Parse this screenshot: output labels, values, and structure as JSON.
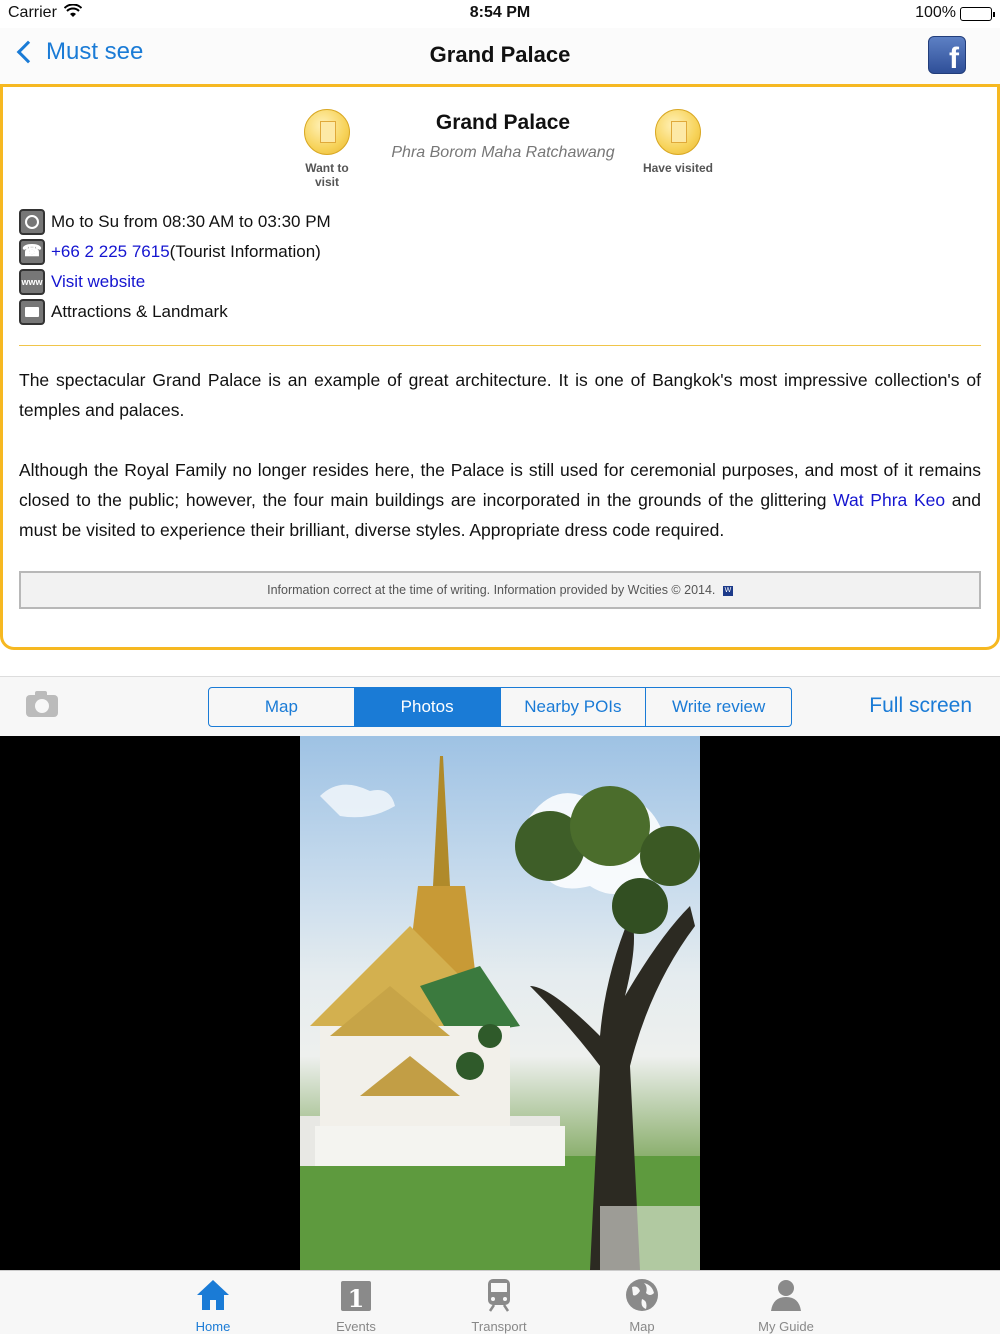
{
  "status": {
    "carrier": "Carrier",
    "time": "8:54 PM",
    "battery": "100%"
  },
  "nav": {
    "back_label": "Must see",
    "title": "Grand Palace",
    "facebook": "f"
  },
  "poi": {
    "title": "Grand Palace",
    "subtitle": "Phra Borom Maha Ratchawang",
    "want_to_visit": "Want to visit",
    "have_visited": "Have visited",
    "hours": "Mo to Su from 08:30 AM to 03:30 PM",
    "phone": "+66 2 225 7615",
    "phone_note": "(Tourist Information)",
    "website_icon": "www",
    "website": "Visit website",
    "category": "Attractions & Landmark",
    "para1": "The spectacular Grand Palace is an example of great architecture. It is one of Bangkok's most impressive collection's of temples and palaces.",
    "para2_start": "Although the Royal Family no longer resides here, the Palace is still used for ceremonial purposes, and most of it remains closed to the public; however, the four main buildings are incorporated in the grounds of the glittering ",
    "para2_link": "Wat Phra Keo",
    "para2_end": " and must be visited to experience their brilliant, diverse styles. Appropriate dress code required.",
    "credit": "Information correct at the time of writing. Information provided by Wcities © 2014.",
    "credit_logo": "W"
  },
  "segments": {
    "map": "Map",
    "photos": "Photos",
    "nearby": "Nearby POIs",
    "review": "Write review",
    "active": "Photos"
  },
  "fullscreen": "Full screen",
  "tabs": {
    "home": "Home",
    "events": "Events",
    "transport": "Transport",
    "map": "Map",
    "guide": "My Guide",
    "events_icon_digit": "1"
  },
  "colors": {
    "accent": "#1a7bd6",
    "card_border": "#f6b821",
    "link": "#1515d0"
  }
}
